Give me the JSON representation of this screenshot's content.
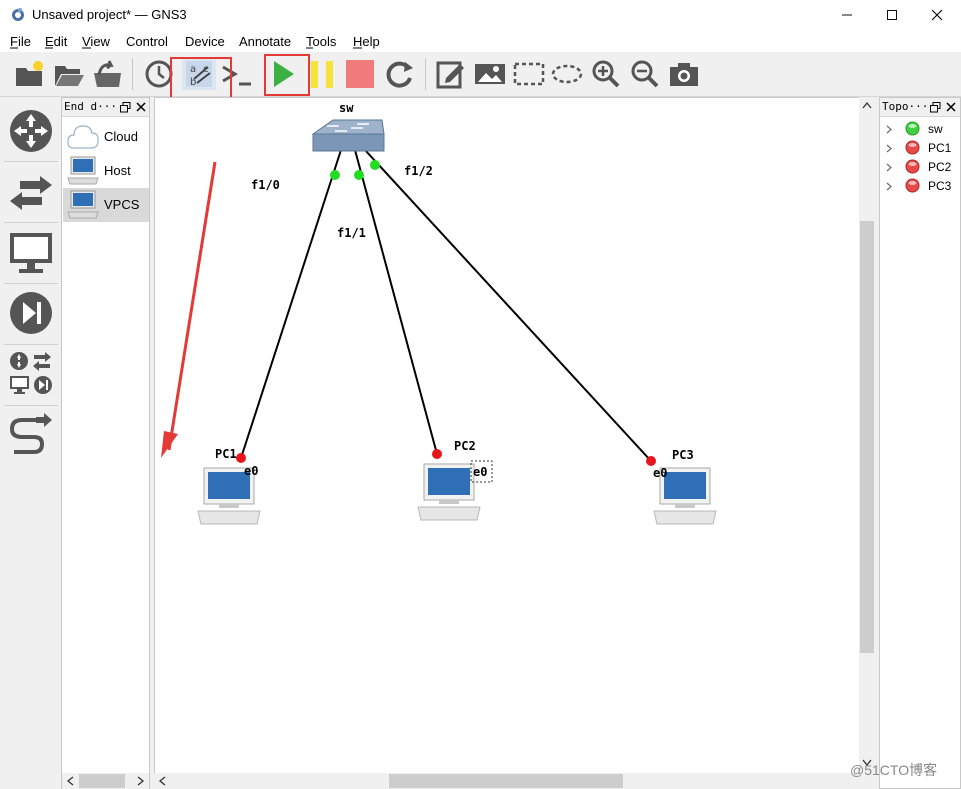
{
  "window": {
    "title": "Unsaved project* — GNS3",
    "controls": {
      "minimize": "—",
      "maximize": "☐",
      "close": "✕"
    }
  },
  "menubar": {
    "items": [
      "File",
      "Edit",
      "View",
      "Control",
      "Device",
      "Annotate",
      "Tools",
      "Help"
    ],
    "mnemonics": [
      "F",
      "E",
      "V",
      "",
      "",
      "",
      "T",
      "H"
    ]
  },
  "toolbar": {
    "icons": [
      "new-project-icon",
      "open-project-icon",
      "save-project-icon",
      "snapshot-clock-icon",
      "show-interface-labels-icon",
      "console-all-icon",
      "start-all-icon",
      "suspend-all-icon",
      "stop-all-icon",
      "reload-all-icon",
      "add-note-icon",
      "insert-image-icon",
      "draw-rectangle-icon",
      "draw-ellipse-icon",
      "zoom-in-icon",
      "zoom-out-icon",
      "screenshot-icon"
    ],
    "highlighted": [
      "show-interface-labels-icon",
      "start-all-icon"
    ],
    "colors": {
      "start": "#3cb043",
      "suspend": "#f5e33b",
      "stop": "#f07b7b",
      "highlight": "#e53935"
    }
  },
  "device_types": [
    "routers-icon",
    "switches-icon",
    "end-devices-icon",
    "security-devices-icon",
    "all-devices-icon",
    "add-link-icon"
  ],
  "end_devices_dock": {
    "title": "End d···",
    "items": [
      {
        "label": "Cloud",
        "icon": "cloud-icon"
      },
      {
        "label": "Host",
        "icon": "host-icon"
      },
      {
        "label": "VPCS",
        "icon": "vpcs-icon",
        "selected": true
      }
    ]
  },
  "topology": {
    "nodes": [
      {
        "name": "sw",
        "type": "switch"
      },
      {
        "name": "PC1",
        "type": "vpcs"
      },
      {
        "name": "PC2",
        "type": "vpcs"
      },
      {
        "name": "PC3",
        "type": "vpcs"
      }
    ],
    "links": [
      {
        "from": "sw",
        "from_port": "f1/0",
        "to": "PC1",
        "to_port": "e0",
        "sw_status": "up",
        "pc_status": "down"
      },
      {
        "from": "sw",
        "from_port": "f1/1",
        "to": "PC2",
        "to_port": "e0",
        "sw_status": "up",
        "pc_status": "down"
      },
      {
        "from": "sw",
        "from_port": "f1/2",
        "to": "PC3",
        "to_port": "e0",
        "sw_status": "up",
        "pc_status": "down"
      }
    ],
    "status_colors": {
      "up": "#22dd22",
      "down": "#e8141b"
    }
  },
  "topology_summary": {
    "title": "Topo···",
    "items": [
      {
        "name": "sw",
        "status": "started"
      },
      {
        "name": "PC1",
        "status": "stopped"
      },
      {
        "name": "PC2",
        "status": "stopped"
      },
      {
        "name": "PC3",
        "status": "stopped"
      }
    ]
  },
  "watermark": "@51CTO博客"
}
